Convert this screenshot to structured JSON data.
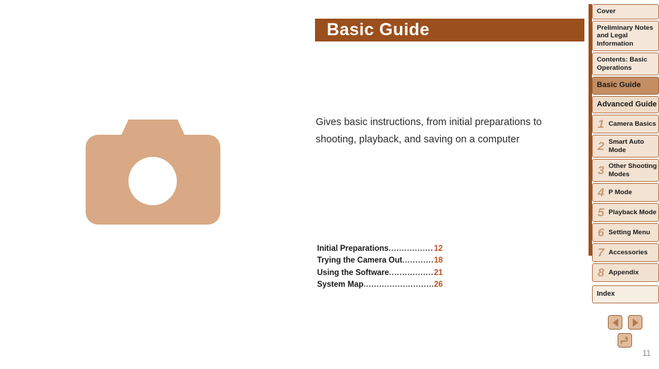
{
  "header": {
    "title": "Basic Guide",
    "bar_color": "#9b4f1c"
  },
  "main": {
    "description": "Gives basic instructions, from initial preparations to shooting, playback, and saving on a computer",
    "illustration_icon": "camera-icon",
    "illustration_color": "#d8a984"
  },
  "toc": {
    "leader": "..............................................................",
    "entries": [
      {
        "label": "Initial Preparations",
        "page": "12"
      },
      {
        "label": "Trying the Camera Out",
        "page": "18"
      },
      {
        "label": "Using the Software",
        "page": "21"
      },
      {
        "label": "System Map ",
        "page": "26"
      }
    ],
    "page_color": "#c4511f"
  },
  "sidebar": {
    "accent_color": "#9b4f1c",
    "active_color": "#c58d62",
    "items": [
      {
        "label": "Cover",
        "type": "plain",
        "number": ""
      },
      {
        "label": "Preliminary Notes and Legal Information",
        "type": "plain",
        "number": ""
      },
      {
        "label": "Contents: Basic Operations",
        "type": "plain",
        "number": ""
      },
      {
        "label": "Basic Guide",
        "type": "active",
        "number": ""
      },
      {
        "label": "Advanced Guide",
        "type": "section",
        "number": ""
      },
      {
        "label": "Camera Basics",
        "type": "chapter",
        "number": "1"
      },
      {
        "label": "Smart Auto Mode",
        "type": "chapter",
        "number": "2"
      },
      {
        "label": "Other Shooting Modes",
        "type": "chapter",
        "number": "3"
      },
      {
        "label": "P Mode",
        "type": "chapter",
        "number": "4"
      },
      {
        "label": "Playback Mode",
        "type": "chapter",
        "number": "5"
      },
      {
        "label": "Setting Menu",
        "type": "chapter",
        "number": "6"
      },
      {
        "label": "Accessories",
        "type": "chapter",
        "number": "7"
      },
      {
        "label": "Appendix",
        "type": "chapter",
        "number": "8"
      },
      {
        "label": "Index",
        "type": "index",
        "number": ""
      }
    ]
  },
  "navigation": {
    "prev_label": "previous-page",
    "next_label": "next-page",
    "back_label": "return-to-previous-view",
    "page_number": "11"
  }
}
